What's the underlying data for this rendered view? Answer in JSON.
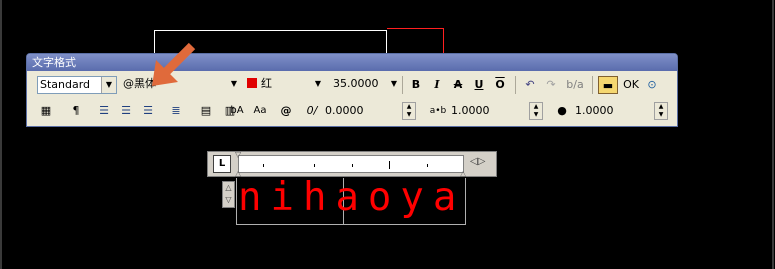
{
  "toolbar": {
    "title": "文字格式",
    "style_value": "Standard",
    "font_value": "@黑体",
    "color_value": "红",
    "height_value": "35.0000",
    "bold": "B",
    "italic": "I",
    "strike": "A",
    "underline": "U",
    "overline": "O",
    "ok_label": "OK",
    "oblique_value": "0.0000",
    "tracking_value": "1.0000",
    "width_value": "1.0000",
    "tracking_icon_text": "a•b",
    "oblique_icon_text": "0/",
    "at_icon_text": "@",
    "upper_icon_text": "bA",
    "lower_icon_text": "Aa"
  },
  "ruler": {
    "tab_label": "L"
  },
  "editor": {
    "text": "nihaoya"
  },
  "colors": {
    "text_red": "#ff0000",
    "highlight_arrow": "#e06a3b"
  }
}
